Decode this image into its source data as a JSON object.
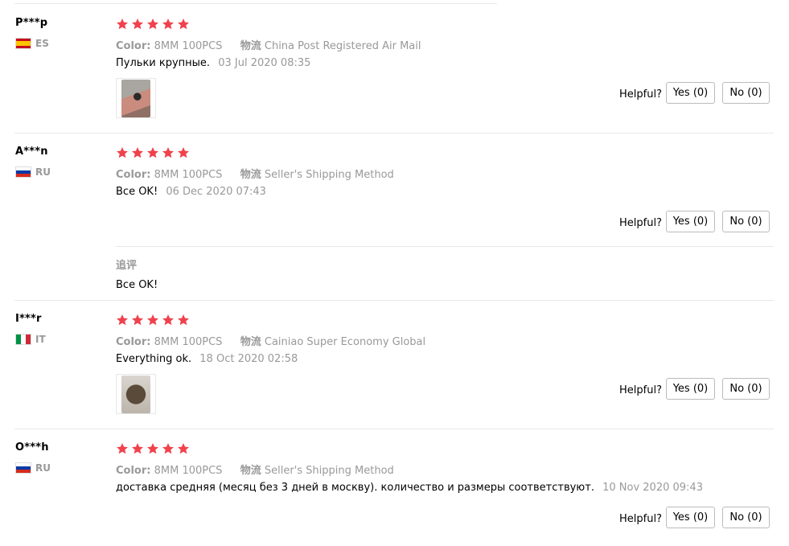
{
  "colors": {
    "star": "#f0424d",
    "muted": "#999999",
    "separator": "#e8e8e8",
    "button_border": "#bbbbbb"
  },
  "labels": {
    "color_key": "Color:",
    "shipping_key": "物流",
    "helpful": "Helpful?",
    "followup": "追评"
  },
  "reviews": [
    {
      "user": "P***p",
      "country": "ES",
      "rating": 5,
      "color_value": "8MM 100PCS",
      "shipping": "China Post Registered Air Mail",
      "text": "Пульки крупные.",
      "date": "03 Jul 2020 08:35",
      "has_photo": true,
      "yes": "Yes (0)",
      "no": "No (0)"
    },
    {
      "user": "A***n",
      "country": "RU",
      "rating": 5,
      "color_value": "8MM 100PCS",
      "shipping": "Seller's Shipping Method",
      "text": "Все OK!",
      "date": "06 Dec 2020 07:43",
      "has_photo": false,
      "yes": "Yes (0)",
      "no": "No (0)",
      "followup_text": "Все OK!"
    },
    {
      "user": "I***r",
      "country": "IT",
      "rating": 5,
      "color_value": "8MM 100PCS",
      "shipping": "Cainiao Super Economy Global",
      "text": "Everything ok.",
      "date": "18 Oct 2020 02:58",
      "has_photo": true,
      "yes": "Yes (0)",
      "no": "No (0)"
    },
    {
      "user": "O***h",
      "country": "RU",
      "rating": 5,
      "color_value": "8MM 100PCS",
      "shipping": "Seller's Shipping Method",
      "text": "доставка средняя (месяц без 3 дней в москву). количество и размеры соответствуют.",
      "date": "10 Nov 2020 09:43",
      "has_photo": false,
      "yes": "Yes (0)",
      "no": "No (0)"
    }
  ]
}
